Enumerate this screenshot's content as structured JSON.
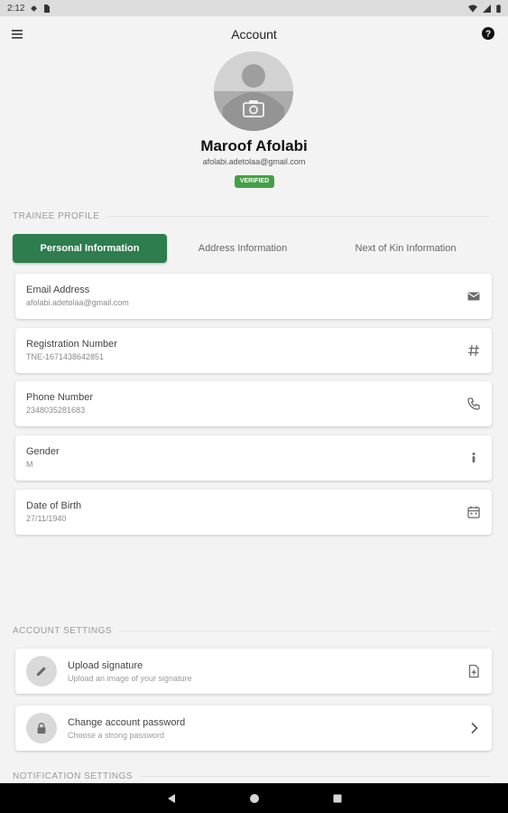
{
  "status_bar": {
    "time": "2:12"
  },
  "app_bar": {
    "title": "Account"
  },
  "profile": {
    "name": "Maroof Afolabi",
    "email": "afolabi.adetolaa@gmail.com",
    "badge": "VERIFIED"
  },
  "trainee_section": {
    "title": "TRAINEE PROFILE",
    "tabs": [
      {
        "label": "Personal Information",
        "active": true
      },
      {
        "label": "Address Information",
        "active": false
      },
      {
        "label": "Next of Kin Information",
        "active": false
      }
    ],
    "fields": [
      {
        "label": "Email Address",
        "value": "afolabi.adetolaa@gmail.com",
        "icon": "mail-icon"
      },
      {
        "label": "Registration Number",
        "value": "TNE-1671438642851",
        "icon": "hash-icon"
      },
      {
        "label": "Phone Number",
        "value": "2348035281683",
        "icon": "phone-icon"
      },
      {
        "label": "Gender",
        "value": "M",
        "icon": "person-icon"
      },
      {
        "label": "Date of Birth",
        "value": "27/11/1940",
        "icon": "calendar-icon"
      }
    ]
  },
  "account_settings": {
    "title": "ACCOUNT SETTINGS",
    "items": [
      {
        "title": "Upload signature",
        "subtitle": "Upload an image of your signature",
        "icon": "pencil-icon",
        "trailing": "file-upload-icon"
      },
      {
        "title": "Change account password",
        "subtitle": "Choose a strong password",
        "icon": "lock-icon",
        "trailing": "chevron-right-icon"
      }
    ]
  },
  "notification_settings": {
    "title": "NOTIFICATION SETTINGS"
  },
  "colors": {
    "accent": "#2e7d4f",
    "verified": "#43a047",
    "background": "#f3f3f3"
  }
}
